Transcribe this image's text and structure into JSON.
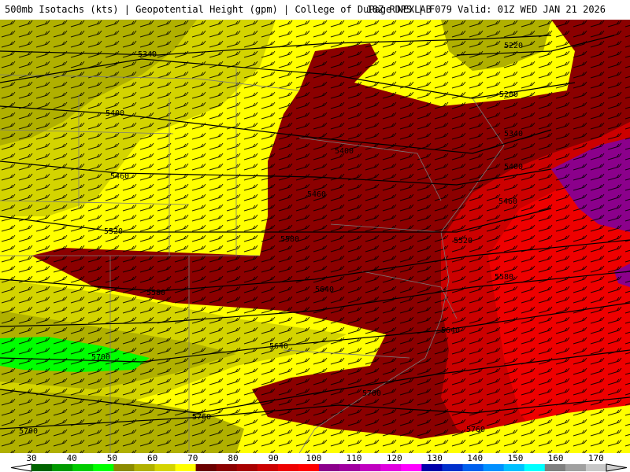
{
  "header": {
    "title_left": "500mb Isotachs (kts) | Geopotential Height (gpm) | College of DuPage NEXLAB",
    "title_right": "18Z RDPS | F079 Valid: 01Z WED JAN 21 2026"
  },
  "legend": {
    "labels": [
      "30",
      "40",
      "50",
      "60",
      "70",
      "80",
      "90",
      "100",
      "110",
      "120",
      "130",
      "140",
      "150",
      "160",
      "170"
    ],
    "colors": [
      "#006400",
      "#009900",
      "#00cc00",
      "#00ff00",
      "#8b8b00",
      "#b0b000",
      "#d4d400",
      "#ffff00",
      "#6b0000",
      "#8b0000",
      "#a80000",
      "#cc0000",
      "#ee0000",
      "#ff0000",
      "#8b008b",
      "#a000a0",
      "#c000c0",
      "#e000e0",
      "#ff00ff",
      "#0000aa",
      "#0030cc",
      "#0060ee",
      "#0090ff",
      "#00c0ff",
      "#00ffff",
      "#808080",
      "#a0a0a0",
      "#c8c8c8"
    ]
  },
  "contours": [
    {
      "label": "5340"
    },
    {
      "label": "5220"
    },
    {
      "label": "5280"
    },
    {
      "label": "5400"
    },
    {
      "label": "5340"
    },
    {
      "label": "5400"
    },
    {
      "label": "5460"
    },
    {
      "label": "5460"
    },
    {
      "label": "5400"
    },
    {
      "label": "5520"
    },
    {
      "label": "5580"
    },
    {
      "label": "5520"
    },
    {
      "label": "5580"
    },
    {
      "label": "5580"
    },
    {
      "label": "5640"
    },
    {
      "label": "5640"
    },
    {
      "label": "5640"
    },
    {
      "label": "5700"
    },
    {
      "label": "5700"
    },
    {
      "label": "5760"
    },
    {
      "label": "5760"
    },
    {
      "label": "5700"
    },
    {
      "label": "5460"
    }
  ]
}
